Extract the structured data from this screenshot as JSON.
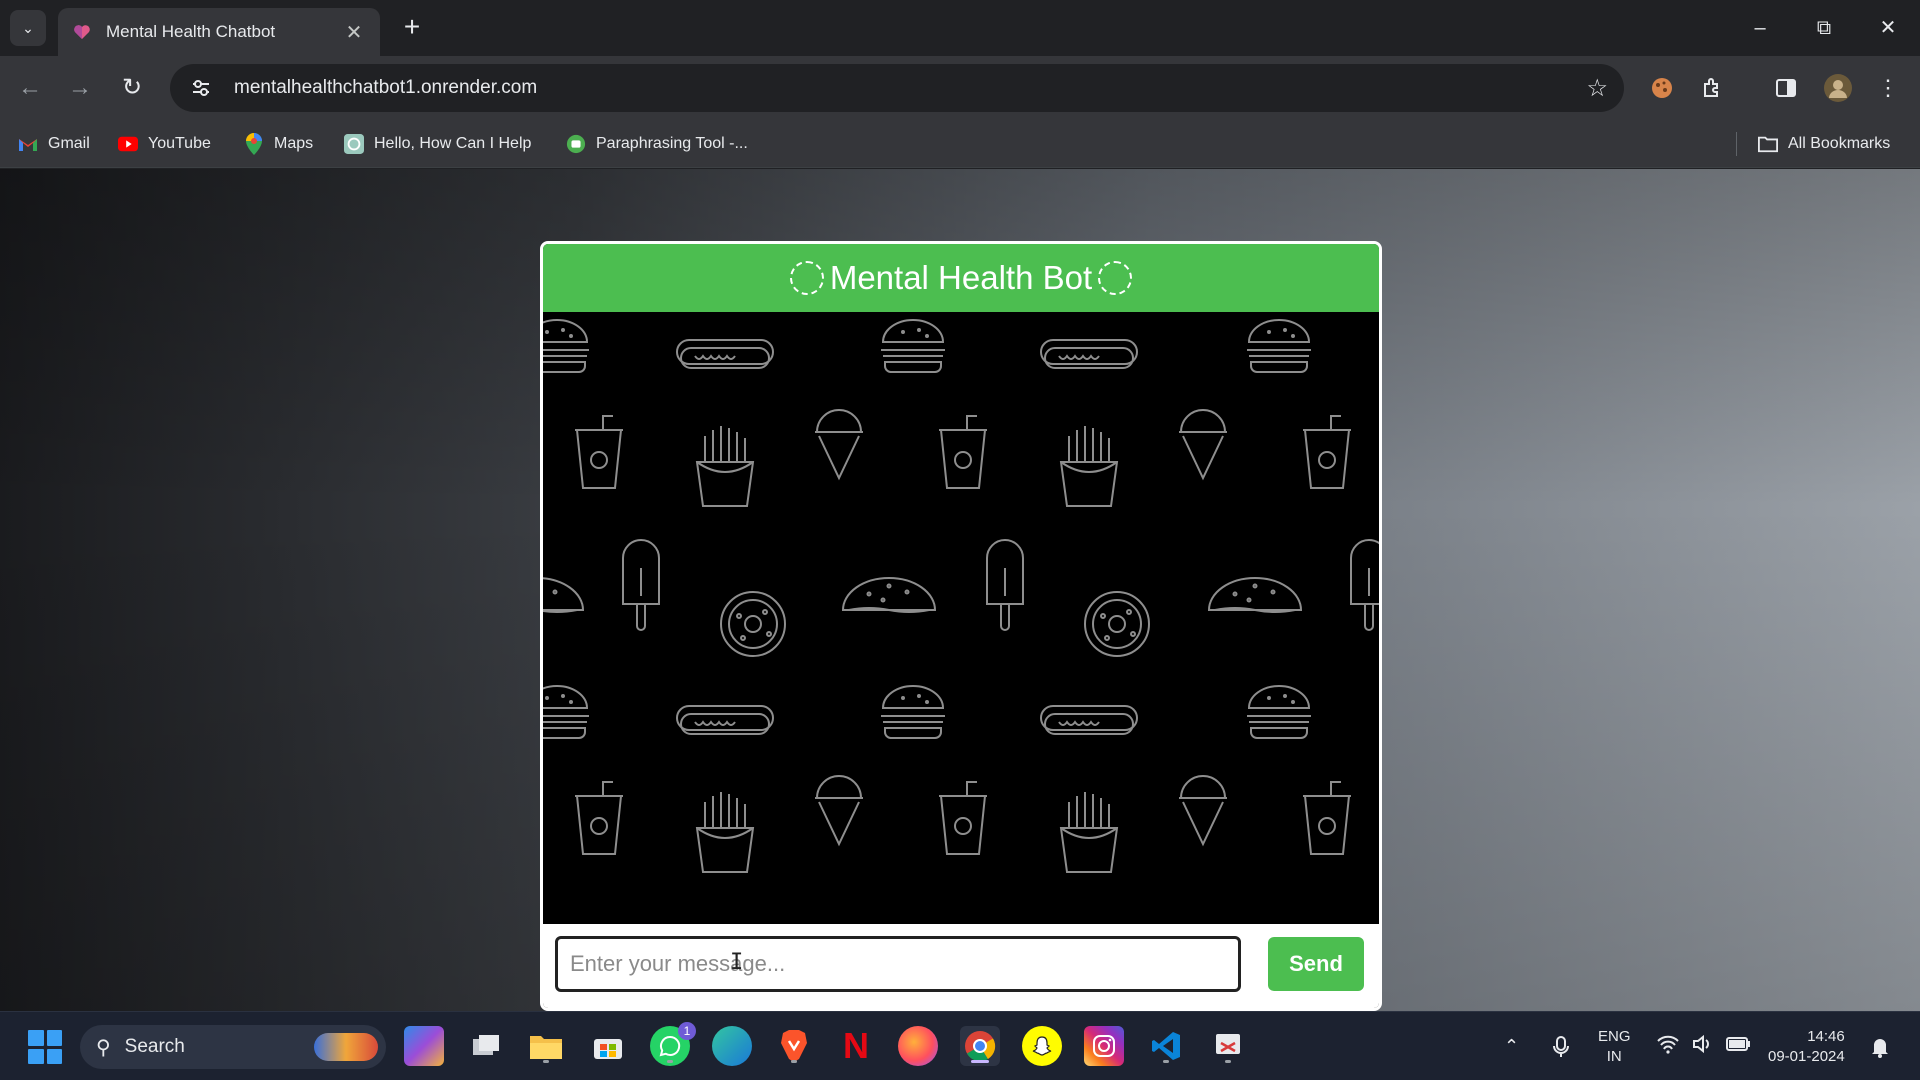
{
  "browser": {
    "tab": {
      "title": "Mental Health Chatbot",
      "favicon": "heart-icon"
    },
    "new_tab_label": "+",
    "url": "mentalhealthchatbot1.onrender.com",
    "bookmarks": [
      {
        "label": "Gmail",
        "icon": "gmail-icon"
      },
      {
        "label": "YouTube",
        "icon": "youtube-icon"
      },
      {
        "label": "Maps",
        "icon": "maps-icon"
      },
      {
        "label": "Hello, How Can I Help",
        "icon": "chatgpt-icon"
      },
      {
        "label": "Paraphrasing Tool -...",
        "icon": "quillbot-icon"
      }
    ],
    "all_bookmarks_label": "All Bookmarks"
  },
  "chat": {
    "title": "Mental Health Bot",
    "input_placeholder": "Enter your message...",
    "send_label": "Send",
    "accent_color": "#4cbe50",
    "background_pattern": "food-doodle-pattern"
  },
  "taskbar": {
    "search_label": "Search",
    "apps": [
      "copilot-icon",
      "task-view-icon",
      "file-explorer-icon",
      "microsoft-store-icon",
      "whatsapp-icon",
      "edge-icon",
      "brave-icon",
      "netflix-icon",
      "firefox-icon",
      "chrome-icon",
      "snapchat-icon",
      "instagram-icon",
      "vscode-icon",
      "snipping-tool-icon"
    ],
    "whatsapp_badge": "1",
    "language": "ENG",
    "region": "IN",
    "time": "14:46",
    "date": "09-01-2024"
  }
}
